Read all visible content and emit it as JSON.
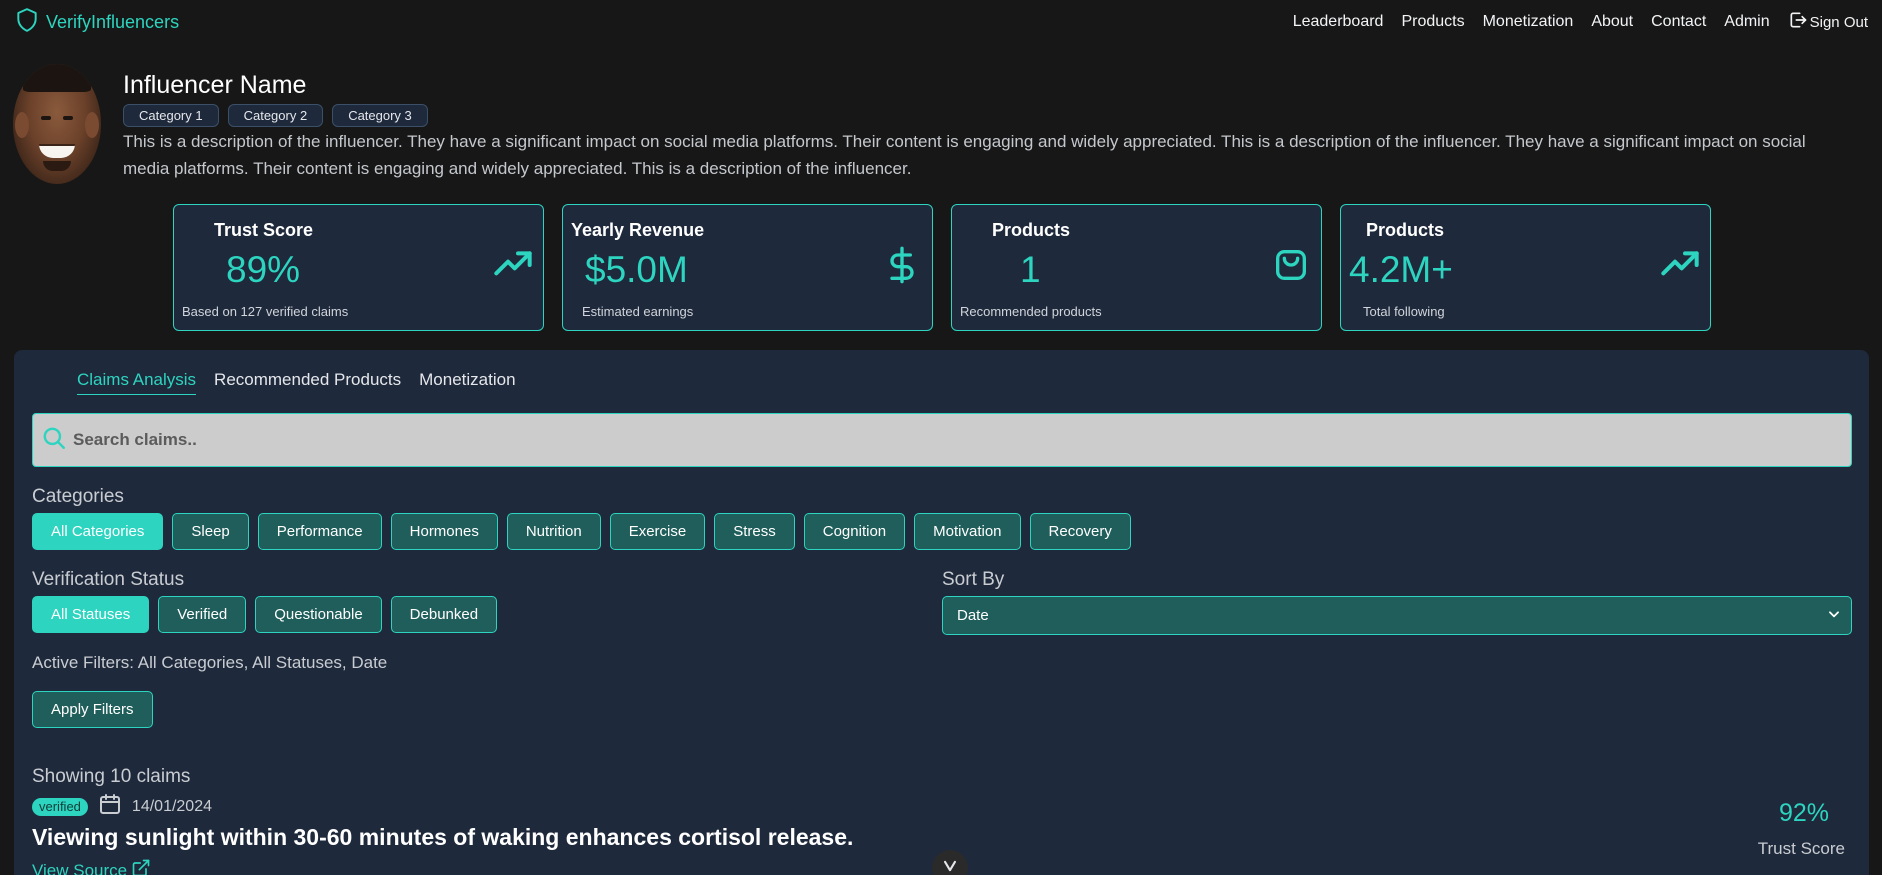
{
  "nav": {
    "brand": "VerifyInfluencers",
    "links": [
      "Leaderboard",
      "Products",
      "Monetization",
      "About",
      "Contact",
      "Admin"
    ],
    "sign_out": "Sign Out"
  },
  "profile": {
    "name": "Influencer Name",
    "categories": [
      "Category 1",
      "Category 2",
      "Category 3"
    ],
    "description": "This is a description of the influencer. They have a significant impact on social media platforms. Their content is engaging and widely appreciated. This is a description of the influencer. They have a significant impact on social media platforms. Their content is engaging and widely appreciated. This is a description of the influencer."
  },
  "stats": [
    {
      "title": "Trust Score",
      "value": "89%",
      "sub": "Based on 127 verified claims",
      "icon": "trending-up-icon"
    },
    {
      "title": "Yearly Revenue",
      "value": "$5.0M",
      "sub": "Estimated earnings",
      "icon": "dollar-icon"
    },
    {
      "title": "Products",
      "value": "1",
      "sub": "Recommended products",
      "icon": "shopping-bag-icon"
    },
    {
      "title": "Products",
      "value": "4.2M+",
      "sub": "Total following",
      "icon": "trending-up-icon"
    }
  ],
  "tabs": [
    {
      "label": "Claims Analysis",
      "active": true
    },
    {
      "label": "Recommended Products",
      "active": false
    },
    {
      "label": "Monetization",
      "active": false
    }
  ],
  "search": {
    "placeholder": "Search claims.."
  },
  "categories": {
    "label": "Categories",
    "items": [
      "All Categories",
      "Sleep",
      "Performance",
      "Hormones",
      "Nutrition",
      "Exercise",
      "Stress",
      "Cognition",
      "Motivation",
      "Recovery"
    ],
    "active": "All Categories"
  },
  "verification": {
    "label": "Verification Status",
    "items": [
      "All Statuses",
      "Verified",
      "Questionable",
      "Debunked"
    ],
    "active": "All Statuses"
  },
  "sort": {
    "label": "Sort By",
    "value": "Date"
  },
  "active_filters": "Active Filters: All Categories, All Statuses, Date",
  "apply_label": "Apply Filters",
  "showing": "Showing 10 claims",
  "claim": {
    "status": "verified",
    "date": "14/01/2024",
    "text": "Viewing sunlight within 30-60 minutes of waking enhances cortisol release.",
    "source_label": "View Source",
    "score": "92%",
    "score_label": "Trust Score"
  },
  "colors": {
    "accent": "#2dd4bf",
    "panel": "#1e293b",
    "background": "#171717",
    "chip": "#1f5e5a"
  }
}
